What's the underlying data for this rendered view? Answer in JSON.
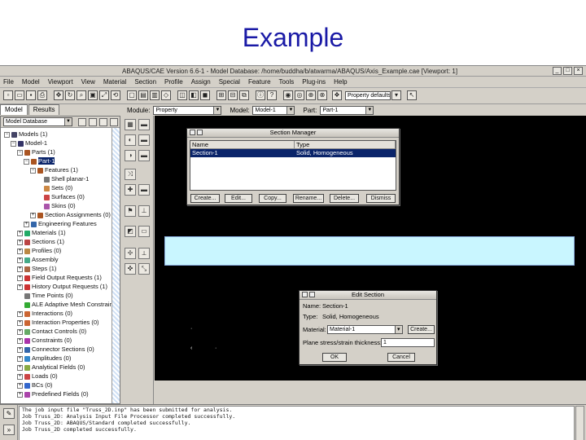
{
  "slide": {
    "title": "Example"
  },
  "window": {
    "title": "ABAQUS/CAE Version 6.6-1 - Model Database: /home/buddha/b/atwarma/ABAQUS/Axis_Example.cae [Viewport: 1]",
    "menu": [
      "File",
      "Model",
      "Viewport",
      "View",
      "Material",
      "Section",
      "Profile",
      "Assign",
      "Special",
      "Feature",
      "Tools",
      "Plug-ins",
      "Help"
    ],
    "toolbar_select": "Property defaults"
  },
  "tabs": [
    "Model",
    "Results"
  ],
  "context": {
    "module_label": "Module:",
    "module_value": "Property",
    "model_label": "Model:",
    "model_value": "Model-1",
    "part_label": "Part:",
    "part_value": "Part-1"
  },
  "tree": {
    "selector": "Model Database",
    "rows": [
      "Models (1)",
      "Model-1",
      "Parts (1)",
      "Part-1",
      "Features (1)",
      "Shell planar-1",
      "Sets (0)",
      "Surfaces (0)",
      "Skins (0)",
      "Section Assignments (0)",
      "Engineering Features",
      "Materials (1)",
      "Sections (1)",
      "Profiles (0)",
      "Assembly",
      "Steps (1)",
      "Field Output Requests (1)",
      "History Output Requests (1)",
      "Time Points (0)",
      "ALE Adaptive Mesh Constraints",
      "Interactions (0)",
      "Interaction Properties (0)",
      "Contact Controls (0)",
      "Constraints (0)",
      "Connector Sections (0)",
      "Amplitudes (0)",
      "Analytical Fields (0)",
      "Loads (0)",
      "BCs (0)",
      "Predefined Fields (0)"
    ]
  },
  "section_manager": {
    "title": "Section Manager",
    "columns": [
      "Name",
      "Type"
    ],
    "row": {
      "name": "Section-1",
      "type": "Solid, Homogeneous"
    },
    "buttons": [
      "Create...",
      "Edit...",
      "Copy...",
      "Rename...",
      "Delete...",
      "Dismiss"
    ]
  },
  "edit_section": {
    "title": "Edit Section",
    "name_label": "Name:",
    "name_value": "Section-1",
    "type_label": "Type:",
    "type_value": "Solid, Homogeneous",
    "material_label": "Material:",
    "material_value": "Material-1",
    "create_button": "Create...",
    "thickness_label": "Plane stress/strain thickness:",
    "thickness_value": "1",
    "ok_button": "OK",
    "cancel_button": "Cancel"
  },
  "messages": [
    "The job input file \"Truss_2D.inp\" has been submitted for analysis.",
    "Job Truss_2D: Analysis Input File Processor completed successfully.",
    "Job Truss_2D: ABAQUS/Standard completed successfully.",
    "Job Truss_2D completed successfully."
  ]
}
